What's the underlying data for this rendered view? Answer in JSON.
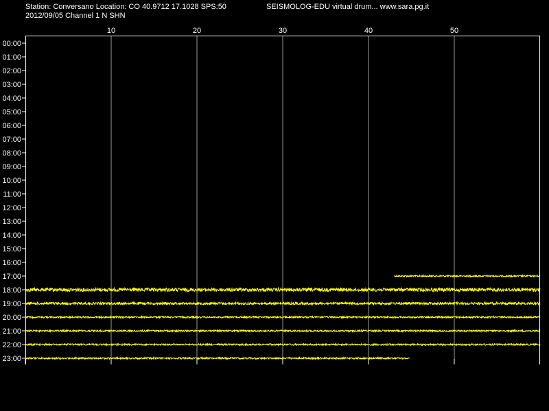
{
  "header": {
    "station_line": "Station: Conversano Location: CO 40.9712 17.1028 SPS:50",
    "app_line": "SEISMOLOG-EDU virtual drum... www.sara.pg.it",
    "date_line": "2012/09/05  Channel 1 N SHN"
  },
  "colors": {
    "background": "#000000",
    "frame": "#ffffff",
    "gridline": "#9a9a9a",
    "trace": "#ffff00",
    "text": "#ffffff"
  },
  "chart_data": {
    "type": "line",
    "title": "",
    "xlabel": "",
    "ylabel": "",
    "x_unit_note": "minutes past the hour",
    "xlim": [
      0,
      60
    ],
    "x_ticks": [
      10,
      20,
      30,
      40,
      50
    ],
    "grid": true,
    "hours": [
      "00:00",
      "01:00",
      "02:00",
      "03:00",
      "04:00",
      "05:00",
      "06:00",
      "07:00",
      "08:00",
      "09:00",
      "10:00",
      "11:00",
      "12:00",
      "13:00",
      "14:00",
      "15:00",
      "16:00",
      "17:00",
      "18:00",
      "19:00",
      "20:00",
      "21:00",
      "22:00",
      "23:00"
    ],
    "traces": [
      {
        "hour": "17:00",
        "start_min": 43.0,
        "end_min": 60.0,
        "amplitude": "low"
      },
      {
        "hour": "18:00",
        "start_min": 0.0,
        "end_min": 60.0,
        "amplitude": "high"
      },
      {
        "hour": "19:00",
        "start_min": 0.0,
        "end_min": 60.0,
        "amplitude": "medium"
      },
      {
        "hour": "20:00",
        "start_min": 0.0,
        "end_min": 60.0,
        "amplitude": "low"
      },
      {
        "hour": "21:00",
        "start_min": 0.0,
        "end_min": 60.0,
        "amplitude": "low"
      },
      {
        "hour": "22:00",
        "start_min": 0.0,
        "end_min": 60.0,
        "amplitude": "low"
      },
      {
        "hour": "23:00",
        "start_min": 0.0,
        "end_min": 44.8,
        "amplitude": "low"
      }
    ]
  }
}
